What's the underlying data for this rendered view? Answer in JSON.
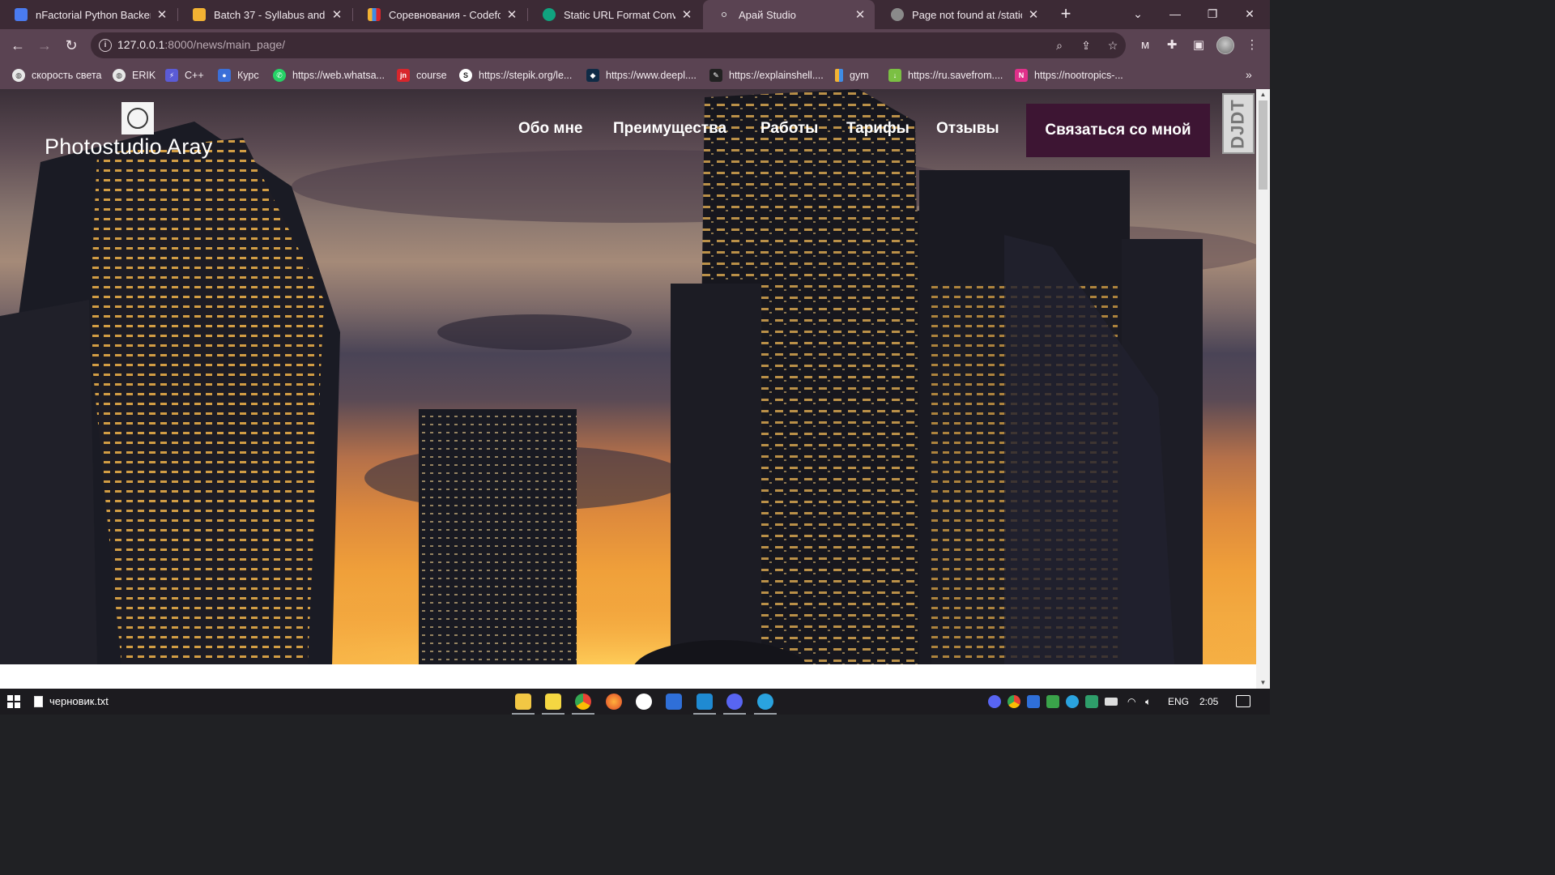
{
  "browser": {
    "tabs": [
      {
        "title": "nFactorial Python Backend",
        "favicon_color": "#4a7bf0",
        "active": false
      },
      {
        "title": "Batch 37 - Syllabus and ma",
        "favicon_color": "#f2b233",
        "active": false
      },
      {
        "title": "Соревнования - Codeforce",
        "favicon_color": "#3f8ce6",
        "active": false
      },
      {
        "title": "Static URL Format Conversio",
        "favicon_color": "#10a37f",
        "active": false
      },
      {
        "title": "Арай Studio",
        "favicon_color": "#c8c8c8",
        "active": true
      },
      {
        "title": "Page not found at /static/n",
        "favicon_color": "#8a8a8a",
        "active": false
      }
    ],
    "close_glyph": "✕",
    "new_tab_glyph": "+",
    "address": {
      "host": "127.0.0.1",
      "rest": ":8000/news/main_page/"
    },
    "bookmarks": [
      {
        "label": "скорость света",
        "icon": "globe-icon",
        "color": "#e8e8e8"
      },
      {
        "label": "ERIK",
        "icon": "globe-icon",
        "color": "#e8e8e8"
      },
      {
        "label": "C++",
        "icon": "bolt-icon",
        "color": "#5b5bd6"
      },
      {
        "label": "Курс",
        "icon": "person-icon",
        "color": "#3b6fd8"
      },
      {
        "label": "https://web.whatsa...",
        "icon": "whatsapp-icon",
        "color": "#25d366"
      },
      {
        "label": "course",
        "icon": "jn-icon",
        "color": "#d8262c"
      },
      {
        "label": "https://stepik.org/le...",
        "icon": "stepik-icon",
        "color": "#ffffff"
      },
      {
        "label": "https://www.deepl....",
        "icon": "deepl-icon",
        "color": "#0f2b46"
      },
      {
        "label": "https://explainshell....",
        "icon": "shell-icon",
        "color": "#222222"
      },
      {
        "label": "gym",
        "icon": "bars-icon",
        "color": "#f2b233"
      },
      {
        "label": "https://ru.savefrom....",
        "icon": "download-icon",
        "color": "#7bc043"
      },
      {
        "label": "https://nootropics-...",
        "icon": "n-icon",
        "color": "#e0308a"
      }
    ]
  },
  "site": {
    "brand": "Photostudio Aray",
    "nav": [
      "Обо мне",
      "Преимущества",
      "Работы",
      "Тарифы",
      "Отзывы"
    ],
    "cta": "Связаться со мной",
    "debug_toolbar": "DJDT"
  },
  "taskbar": {
    "open_file": "черновик.txt",
    "lang": "ENG",
    "time": "2:05"
  },
  "colors": {
    "tab_bar": "#3c2a35",
    "toolbar": "#5a4352",
    "cta_bg": "#3d1533"
  }
}
